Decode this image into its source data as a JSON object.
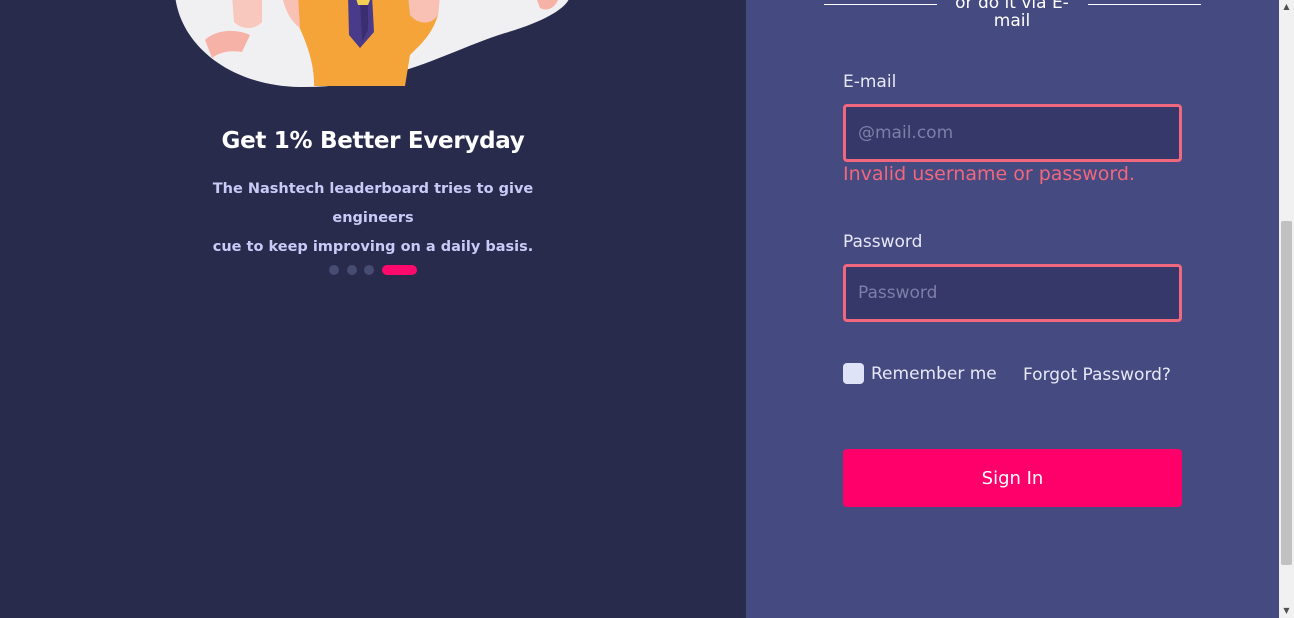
{
  "slide": {
    "title": "Get 1% Better Everyday",
    "text_line1": "The Nashtech leaderboard tries to give engineers",
    "text_line2": "cue to keep improving on a daily basis.",
    "active_index": 3
  },
  "form": {
    "divider_line1": "or do it via E-",
    "divider_line2": "mail",
    "email_label": "E-mail",
    "email_placeholder": "@mail.com",
    "error_text": "Invalid username or password.",
    "password_label": "Password",
    "password_placeholder": "Password",
    "remember_label": "Remember me",
    "forgot_label": "Forgot Password?",
    "signin_label": "Sign In"
  },
  "colors": {
    "left_bg": "#292b4d",
    "right_bg": "#454a80",
    "accent": "#ff006b",
    "error": "#f0677e"
  },
  "icons": {
    "scroll_up": "scroll-up-arrow",
    "scroll_down": "scroll-down-arrow"
  }
}
